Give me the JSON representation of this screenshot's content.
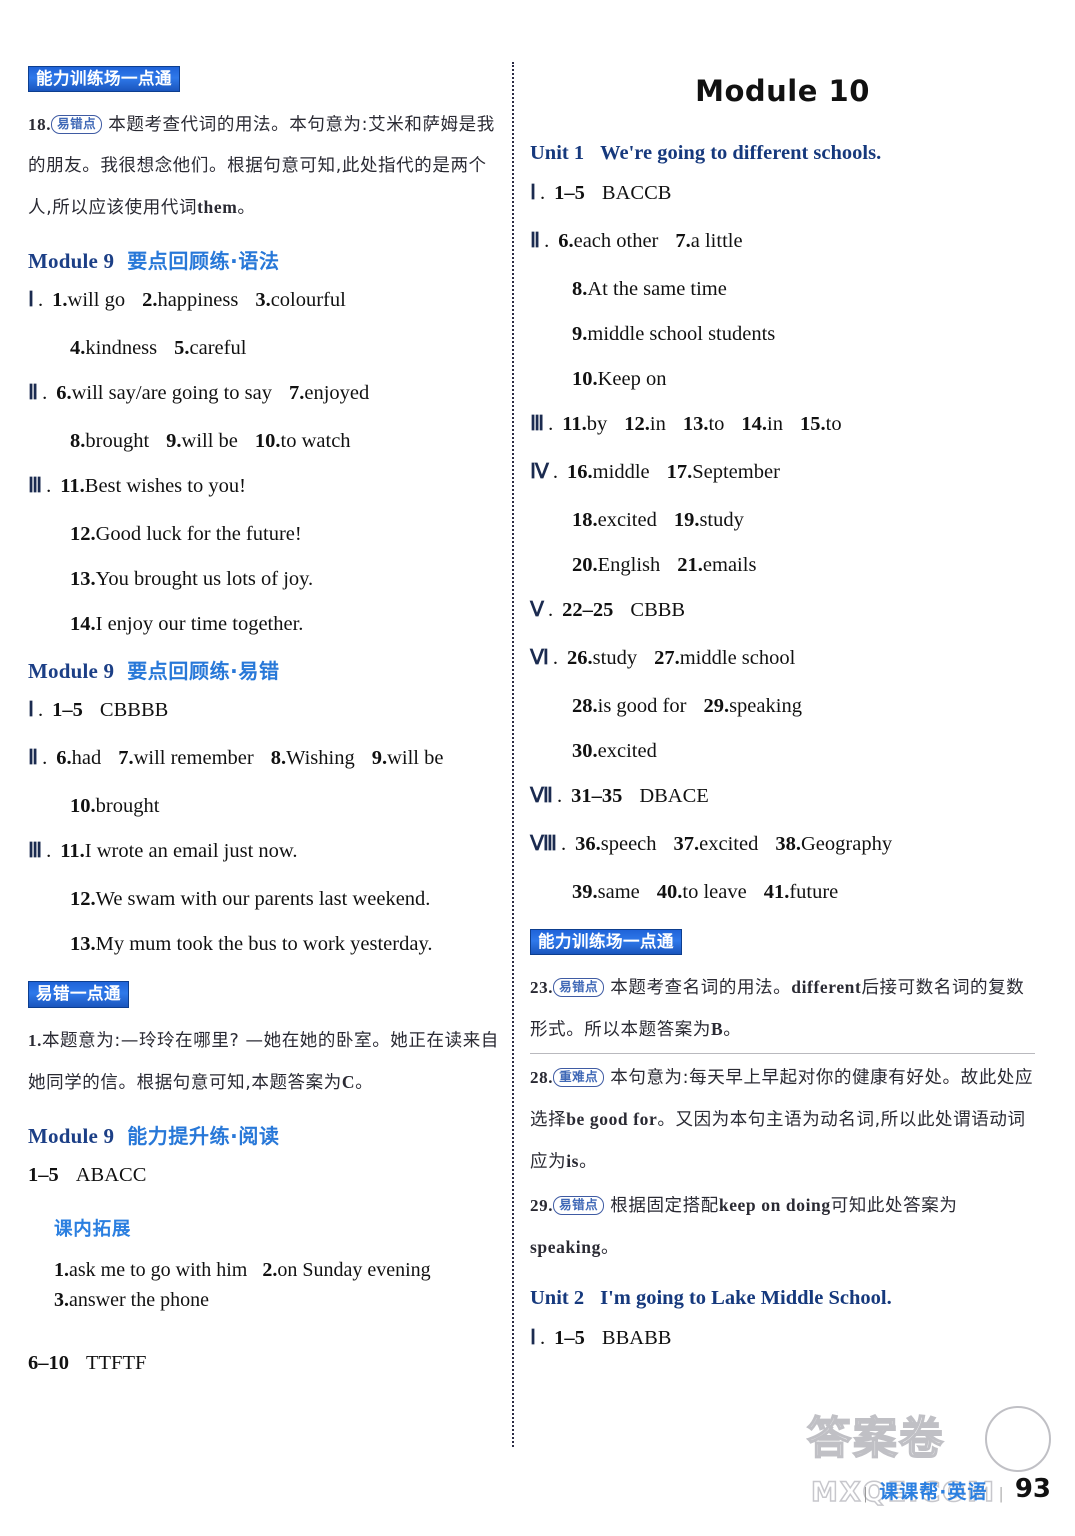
{
  "footer": {
    "brand": "课课帮·英语",
    "separator": "|",
    "page_number": "93",
    "watermark_cn": "答案卷",
    "watermark_url": "MXQE.COM"
  },
  "left_column": {
    "badge_ability": "能力训练场一点通",
    "explanation_18": {
      "number": "18.",
      "tag": "易错点",
      "text": "本题考查代词的用法。本句意为:艾米和萨姆是我的朋友。我很想念他们。根据句意可知,此处指代的是两个人,所以应该使用代词",
      "inline_en": "them",
      "period": "。"
    },
    "module9_grammar": {
      "en": "Module 9",
      "cn": "要点回顾练·语法",
      "rows": [
        {
          "rn": "Ⅰ",
          "indent": false,
          "items": [
            "1.will go",
            "2.happiness",
            "3.colourful"
          ]
        },
        {
          "rn": "",
          "indent": true,
          "items": [
            "4.kindness",
            "5.careful"
          ]
        },
        {
          "rn": "Ⅱ",
          "indent": false,
          "items": [
            "6.will say/are going to say",
            "7.enjoyed"
          ]
        },
        {
          "rn": "",
          "indent": true,
          "items": [
            "8.brought",
            "9.will be",
            "10.to watch"
          ]
        },
        {
          "rn": "Ⅲ",
          "indent": false,
          "items": [
            "11.Best wishes to you!"
          ]
        },
        {
          "rn": "",
          "indent": true,
          "items": [
            "12.Good luck for the future!"
          ]
        },
        {
          "rn": "",
          "indent": true,
          "items": [
            "13.You brought us lots of joy."
          ]
        },
        {
          "rn": "",
          "indent": true,
          "items": [
            "14.I enjoy our time together."
          ]
        }
      ]
    },
    "module9_mistakes": {
      "en": "Module 9",
      "cn": "要点回顾练·易错",
      "rows": [
        {
          "rn": "Ⅰ",
          "indent": false,
          "items": [
            "1–5",
            "CBBBB"
          ]
        },
        {
          "rn": "Ⅱ",
          "indent": false,
          "items": [
            "6.had",
            "7.will remember",
            "8.Wishing",
            "9.will be"
          ]
        },
        {
          "rn": "",
          "indent": true,
          "items": [
            "10.brought"
          ]
        },
        {
          "rn": "Ⅲ",
          "indent": false,
          "items": [
            "11.I wrote an email just now."
          ]
        },
        {
          "rn": "",
          "indent": true,
          "items": [
            "12.We swam with our parents  last weekend."
          ]
        },
        {
          "rn": "",
          "indent": true,
          "items": [
            "13.My mum took the bus to work yesterday."
          ]
        }
      ]
    },
    "badge_mistake": "易错一点通",
    "explanation_1": {
      "number": "1.",
      "text": "本题意为:—玲玲在哪里? —她在她的卧室。她正在读来自她同学的信。根据句意可知,本题答案为",
      "inline_en": "C",
      "period": "。"
    },
    "module9_reading": {
      "en": "Module 9",
      "cn": "能力提升练·阅读",
      "rows": [
        {
          "rn": "",
          "indent": false,
          "items": [
            "1–5",
            "ABACC"
          ]
        }
      ],
      "sub_label": "课内拓展",
      "extension": [
        "1.ask me to go with him   2.on Sunday evening",
        "3.answer the phone"
      ],
      "tail_row": {
        "items": [
          "6–10",
          "TTFTF"
        ]
      }
    }
  },
  "right_column": {
    "module_title": "Module 10",
    "unit1": {
      "no": "Unit 1",
      "title": "We're going to different schools.",
      "rows": [
        {
          "rn": "Ⅰ",
          "indent": false,
          "items": [
            "1–5",
            "BACCB"
          ]
        },
        {
          "rn": "Ⅱ",
          "indent": false,
          "items": [
            "6.each other",
            "7.a little"
          ]
        },
        {
          "rn": "",
          "indent": true,
          "items": [
            "8.At the same time"
          ]
        },
        {
          "rn": "",
          "indent": true,
          "items": [
            "9.middle school students"
          ]
        },
        {
          "rn": "",
          "indent": true,
          "items": [
            "10.Keep on"
          ]
        },
        {
          "rn": "Ⅲ",
          "indent": false,
          "items": [
            "11.by",
            "12.in",
            "13.to",
            "14.in",
            "15.to"
          ]
        },
        {
          "rn": "Ⅳ",
          "indent": false,
          "items": [
            "16.middle",
            "17.September"
          ]
        },
        {
          "rn": "",
          "indent": true,
          "items": [
            "18.excited",
            "19.study"
          ]
        },
        {
          "rn": "",
          "indent": true,
          "items": [
            "20.English",
            "21.emails"
          ]
        },
        {
          "rn": "Ⅴ",
          "indent": false,
          "items": [
            "22–25",
            "CBBB"
          ]
        },
        {
          "rn": "Ⅵ",
          "indent": false,
          "items": [
            "26.study",
            "27.middle school"
          ]
        },
        {
          "rn": "",
          "indent": true,
          "items": [
            "28.is good for",
            "29.speaking"
          ]
        },
        {
          "rn": "",
          "indent": true,
          "items": [
            "30.excited"
          ]
        },
        {
          "rn": "Ⅶ",
          "indent": false,
          "items": [
            "31–35",
            "DBACE"
          ]
        },
        {
          "rn": "Ⅷ",
          "indent": false,
          "items": [
            "36.speech",
            "37.excited",
            "38.Geography"
          ]
        },
        {
          "rn": "",
          "indent": true,
          "items": [
            "39.same",
            "40.to leave",
            "41.future"
          ]
        }
      ]
    },
    "badge_ability": "能力训练场一点通",
    "explanation_23": {
      "number": "23.",
      "tag": "易错点",
      "text_a": "本题考查名词的用法。",
      "inline_en_a": "different",
      "text_b": "后接可数名词的复数形式。所以本题答案为",
      "inline_en_b": "B",
      "period": "。"
    },
    "explanation_28": {
      "number": "28.",
      "tag": "重难点",
      "text_a": "本句意为:每天早上早起对你的健康有好处。故此处应选择",
      "inline_en_a": "be good for",
      "text_b": "。又因为本句主语为动名词,所以此处谓语动词应为",
      "inline_en_b": "is",
      "period": "。"
    },
    "explanation_29": {
      "number": "29.",
      "tag": "易错点",
      "text_a": "根据固定搭配",
      "inline_en_a": "keep on doing",
      "text_b": "可知此处答案为",
      "inline_en_b": "speaking",
      "period": "。"
    },
    "unit2": {
      "no": "Unit 2",
      "title": "I'm going to Lake Middle School.",
      "rows": [
        {
          "rn": "Ⅰ",
          "indent": false,
          "items": [
            "1–5",
            "BBABB"
          ]
        }
      ]
    }
  }
}
